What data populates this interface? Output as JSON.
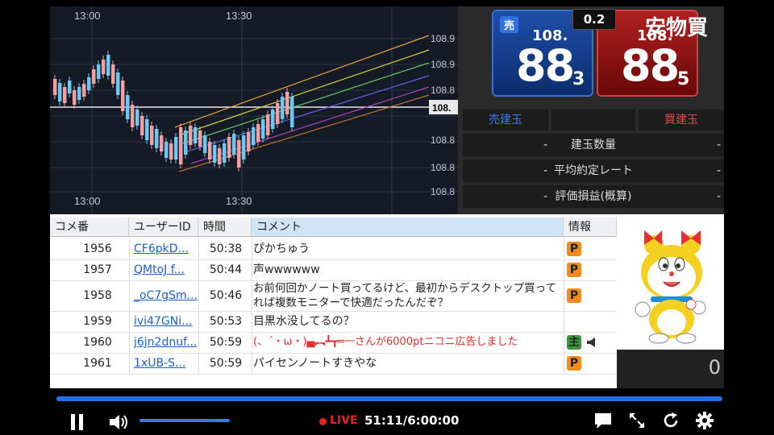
{
  "chart": {
    "time_labels_top": [
      "13:00",
      "13:30"
    ],
    "time_labels_bottom": [
      "13:00",
      "13:30"
    ],
    "price_axis": [
      "108.9",
      "108.9",
      "108.8",
      "108.8",
      "108.8",
      "108.8"
    ],
    "current_price_tag": "108.",
    "colors": {
      "background": "#151b26",
      "up_candle": "#f0a0a0",
      "down_candle": "#6cc8f0",
      "channel": [
        "#e8a040",
        "#d8d040",
        "#60d060",
        "#6060e8",
        "#b040c0",
        "#c07030"
      ]
    }
  },
  "trade": {
    "sell_tag": "売",
    "sell_small": "108.",
    "sell_big": "88",
    "sell_sub": "3",
    "buy_small": "108.",
    "buy_big": "88",
    "buy_sub": "5",
    "spread": "0.2",
    "title": "安物買",
    "tab_sell": "売建玉",
    "tab_buy": "買建玉",
    "rows": [
      "建玉数量",
      "平均約定レート",
      "評価損益(概算)"
    ]
  },
  "comments": {
    "headers": {
      "no": "コメ番",
      "user": "ユーザーID",
      "time": "時間",
      "comment": "コメント",
      "info": "情報"
    },
    "rows": [
      {
        "no": "1956",
        "user": "CF6pkD...",
        "time": "50:38",
        "text": "ぴかちゅう",
        "badge": "P"
      },
      {
        "no": "1957",
        "user": "QMtoJ f...",
        "time": "50:44",
        "text": "声wwwwww",
        "badge": "P"
      },
      {
        "no": "1958",
        "user": "_oC7gSm...",
        "time": "50:46",
        "text": "お前何回かノート買ってるけど、最初からデスクトップ買ってれば複数モニターで快適だったんだぞ？",
        "badge": "P"
      },
      {
        "no": "1959",
        "user": "ivi47GNi...",
        "time": "50:53",
        "text": "目黒水没してるの？",
        "badge": ""
      },
      {
        "no": "1960",
        "user": "j6jn2dnuf...",
        "time": "50:59",
        "text": "(、´・ω・)▄︻┻┳═一さんが6000ptニコニ広告しました",
        "badge": "主"
      },
      {
        "no": "1961",
        "user": "1xUB-S...",
        "time": "50:59",
        "text": "パイセンノートすきやな",
        "badge": "P"
      }
    ]
  },
  "side": {
    "counter": "0"
  },
  "player": {
    "live_label": "LIVE",
    "time": "51:11/6:00:00",
    "volume_level": 0.8,
    "colors": {
      "accent": "#1e6fe0",
      "live": "#e82020"
    }
  }
}
